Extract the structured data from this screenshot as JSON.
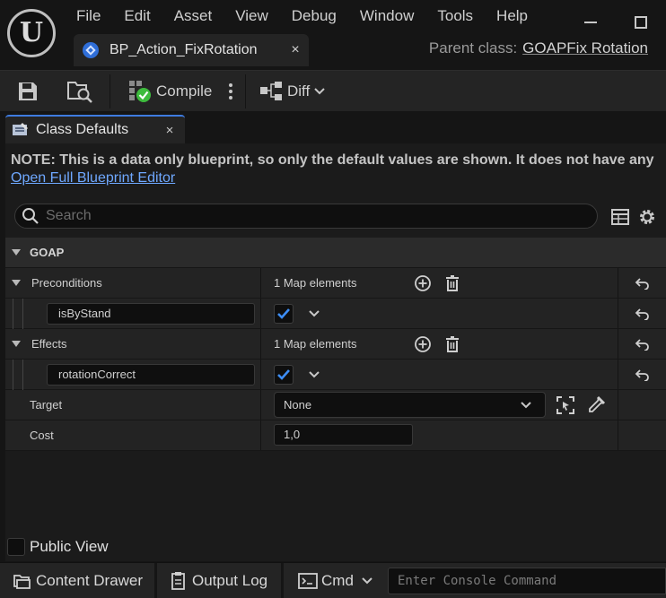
{
  "menu": [
    "File",
    "Edit",
    "Asset",
    "View",
    "Debug",
    "Window",
    "Tools",
    "Help"
  ],
  "document_tab": {
    "label": "BP_Action_FixRotation",
    "close": "×"
  },
  "parent_class": {
    "label": "Parent class:",
    "value": "GOAPFix Rotation"
  },
  "toolbar": {
    "compile_label": "Compile",
    "diff_label": "Diff"
  },
  "panel_tab": {
    "label": "Class Defaults",
    "close": "×"
  },
  "note": {
    "text": "NOTE: This is a data only blueprint, so only the default values are shown.  It does not have any",
    "link": "Open Full Blueprint Editor"
  },
  "search": {
    "placeholder": "Search"
  },
  "category": {
    "label": "GOAP"
  },
  "properties": {
    "preconditions": {
      "label": "Preconditions",
      "value": "1 Map elements",
      "key": "isByStand",
      "checked": true
    },
    "effects": {
      "label": "Effects",
      "value": "1 Map elements",
      "key": "rotationCorrect",
      "checked": true
    },
    "target": {
      "label": "Target",
      "value": "None"
    },
    "cost": {
      "label": "Cost",
      "value": "1,0"
    }
  },
  "public_view": {
    "label": "Public View",
    "checked": false
  },
  "statusbar": {
    "content_drawer": "Content Drawer",
    "output_log": "Output Log",
    "cmd": "Cmd",
    "console_placeholder": "Enter Console Command"
  },
  "colors": {
    "accent": "#3e7be0",
    "link": "#6fa8ff",
    "checkbox_check": "#3d8df5",
    "compile_ok": "#3dbb3d"
  }
}
